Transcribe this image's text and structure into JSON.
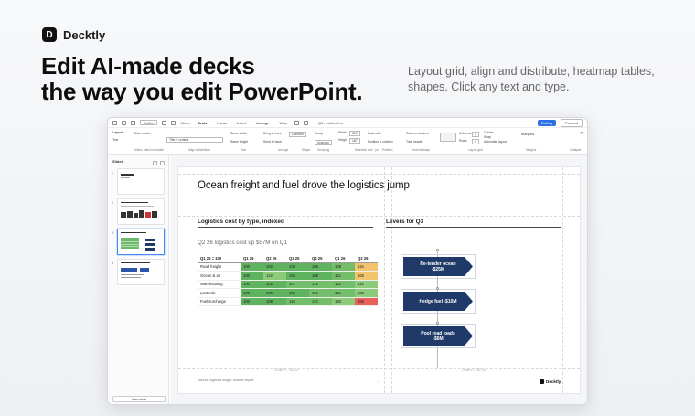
{
  "brand": {
    "logo": "D",
    "name": "Decktly"
  },
  "hero": {
    "line1": "Edit AI-made decks",
    "line2": "the way you edit PowerPoint.",
    "subtitle": "Layout grid, align and distribute, heatmap tables, shapes. Click any text and type."
  },
  "app": {
    "titlebar": {
      "font_select": "Calibri",
      "share": "Share",
      "tabs": [
        "Tools",
        "Home",
        "Insert",
        "Arrange",
        "View"
      ],
      "doc_title": "Q3 results.html",
      "editing_label": "Editing",
      "present_label": "Present",
      "editing_color": "#2f6fe4"
    },
    "ribbon": {
      "layout": "Layout",
      "text": "Text",
      "slide_master": "Slide master",
      "layout_select": "Title + content",
      "group_select": "Select, switch or create",
      "same_width": "Same width",
      "same_height": "Same height",
      "group_size": "Size",
      "bring_front": "Bring to front",
      "send_back": "Send to back",
      "group_arrange": "Arrange",
      "connect": "Connect",
      "group_align": "Align & distribute",
      "group_shape": "Shape",
      "group": "Group",
      "ungroup": "Ungroup",
      "group_grouping": "Grouping",
      "width": "Width",
      "height": "Height",
      "width_val": "310",
      "height_val": "187",
      "group_selection": "Selection size · px",
      "lock_ratio": "Lock ratio",
      "position": "Position & rotation",
      "group_position": "Position",
      "column_headers": "Column headers",
      "total_header": "Total header",
      "group_heatmap": "Heat heatmap",
      "columns": "Columns",
      "rows": "Rows",
      "columns_val": "2",
      "rows_val": "1",
      "guides": "Guides",
      "snap": "Snap",
      "auto_layout": "Automatic layout",
      "group_grid": "Layout grid",
      "margins": "Margins",
      "group_margins": "Margins",
      "collapse": "Collapse"
    },
    "sidebar": {
      "title": "Slides",
      "new_slide": "New slide",
      "slide_numbers": [
        "1",
        "2",
        "3",
        "4"
      ]
    },
    "slide": {
      "title": "Ocean freight and fuel drove the logistics jump",
      "left_heading": "Logistics cost by type, indexed",
      "left_subtitle": "Q2 26 logistics cost up $57M on Q1",
      "right_heading": "Levers for Q3",
      "table": {
        "headers": [
          "Q1 25 = 100",
          "Q1 25",
          "Q2 25",
          "Q3 25",
          "Q4 25",
          "Q1 26",
          "Q2 26"
        ],
        "rows": [
          {
            "label": "Road freight",
            "values": [
              "100",
              "102",
              "103",
              "105",
              "108",
              "115"
            ],
            "colors": [
              "g1",
              "g1",
              "g1",
              "g1",
              "g2",
              "y"
            ]
          },
          {
            "label": "Ocean & air",
            "values": [
              "100",
              "122",
              "105",
              "108",
              "112",
              "165"
            ],
            "colors": [
              "g1",
              "g3",
              "g1",
              "g1",
              "g2",
              "y"
            ]
          },
          {
            "label": "Warehousing",
            "values": [
              "100",
              "102",
              "107",
              "114",
              "113",
              "115"
            ],
            "colors": [
              "g1",
              "g1",
              "g2",
              "g2",
              "g2",
              "g3"
            ]
          },
          {
            "label": "Last mile",
            "values": [
              "100",
              "105",
              "105",
              "110",
              "115",
              "130"
            ],
            "colors": [
              "g1",
              "g1",
              "g1",
              "g2",
              "g2",
              "g3"
            ]
          },
          {
            "label": "Fuel surcharge",
            "values": [
              "100",
              "108",
              "110",
              "110",
              "120",
              "155"
            ],
            "colors": [
              "g1",
              "g1",
              "g2",
              "g2",
              "g3",
              "r"
            ]
          }
        ]
      },
      "levers": [
        {
          "line1": "Re-tender ocean",
          "line2": "-$25M"
        },
        {
          "line1": "Hedge fuel -$10M",
          "line2": ""
        },
        {
          "line1": "Pool road loads",
          "line2": "-$6M"
        }
      ],
      "column_tags": [
        "Column 1 · 387 px",
        "Column 2 · 387 px"
      ],
      "source": "Source: logistics ledger, finance export",
      "footer_logo": "Decktly",
      "lever_color": "#1f3a68"
    }
  }
}
